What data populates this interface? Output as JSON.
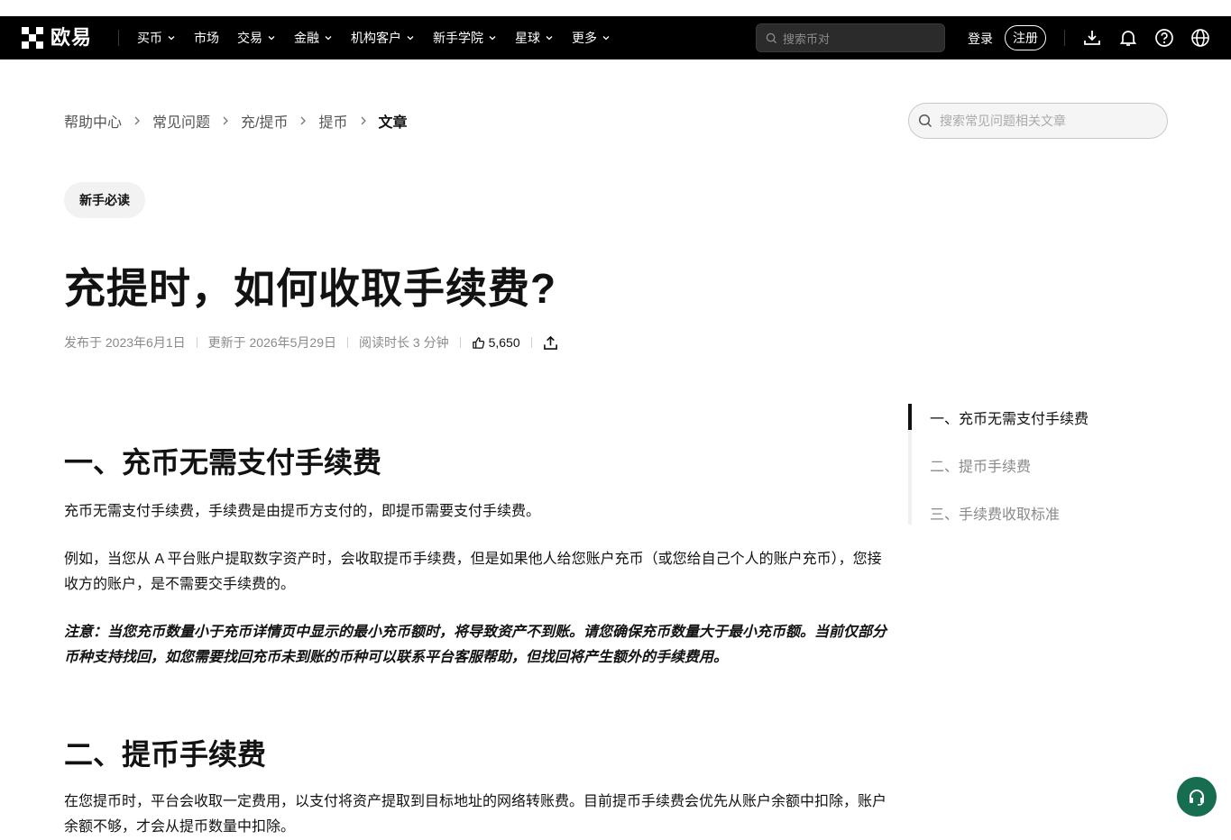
{
  "nav": {
    "logo_text": "欧易",
    "items": [
      {
        "label": "买币",
        "dropdown": true
      },
      {
        "label": "市场",
        "dropdown": false
      },
      {
        "label": "交易",
        "dropdown": true
      },
      {
        "label": "金融",
        "dropdown": true
      },
      {
        "label": "机构客户",
        "dropdown": true
      },
      {
        "label": "新手学院",
        "dropdown": true
      },
      {
        "label": "星球",
        "dropdown": true
      },
      {
        "label": "更多",
        "dropdown": true
      }
    ],
    "search_placeholder": "搜索币对",
    "login": "登录",
    "register": "注册",
    "icons": [
      "download-icon",
      "bell-icon",
      "help-icon",
      "globe-icon"
    ]
  },
  "breadcrumb": [
    "帮助中心",
    "常见问题",
    "充/提币",
    "提币",
    "文章"
  ],
  "help_search_placeholder": "搜索常见问题相关文章",
  "tag": "新手必读",
  "title": "充提时，如何收取手续费?",
  "meta": {
    "published": "发布于 2023年6月1日",
    "updated": "更新于 2026年5月29日",
    "read_time": "阅读时长 3 分钟",
    "likes": "5,650"
  },
  "article": {
    "s1_heading": "一、充币无需支付手续费",
    "s1_p1": "充币无需支付手续费，手续费是由提币方支付的，即提币需要支付手续费。",
    "s1_p2": "例如，当您从 A 平台账户提取数字资产时，会收取提币手续费，但是如果他人给您账户充币（或您给自己个人的账户充币），您接收方的账户，是不需要交手续费的。",
    "s1_note": "注意：当您充币数量小于充币详情页中显示的最小充币额时，将导致资产不到账。请您确保充币数量大于最小充币额。当前仅部分币种支持找回，如您需要找回充币未到账的币种可以联系平台客服帮助，但找回将产生额外的手续费用。",
    "s2_heading": "二、提币手续费",
    "s2_p1": "在您提币时，平台会收取一定费用，以支付将资产提取到目标地址的网络转账费。目前提币手续费会优先从账户余额中扣除，账户余额不够，才会从提币数量中扣除。"
  },
  "toc": [
    "一、充币无需支付手续费",
    "二、提币手续费",
    "三、手续费收取标准"
  ],
  "toc_active_index": 0,
  "colors": {
    "brand": "#000000",
    "support": "#176d50",
    "accent_text": "#121212"
  }
}
